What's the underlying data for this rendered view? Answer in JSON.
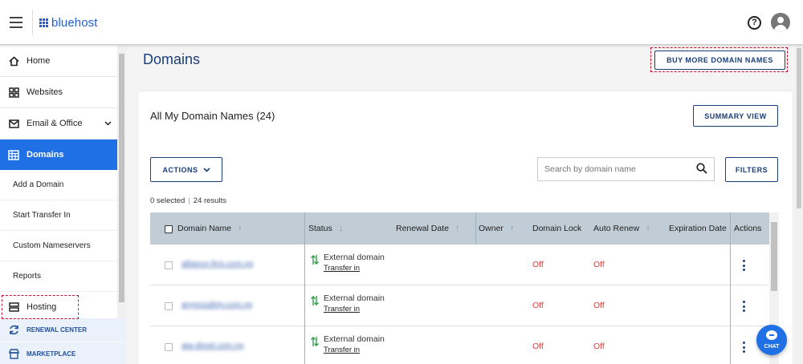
{
  "header": {
    "logo_text": "bluehost",
    "help_glyph": "?"
  },
  "sidebar": {
    "items": [
      {
        "label": "Home",
        "icon": "home-icon"
      },
      {
        "label": "Websites",
        "icon": "websites-icon"
      },
      {
        "label": "Email & Office",
        "icon": "mail-icon",
        "chevron": "⌄"
      },
      {
        "label": "Domains",
        "icon": "domains-icon",
        "active": true
      }
    ],
    "subitems": [
      "Add a Domain",
      "Start Transfer In",
      "Custom Nameservers",
      "Reports"
    ],
    "hosting": "Hosting",
    "renewal_center": "RENEWAL CENTER",
    "marketplace": "MARKETPLACE"
  },
  "main": {
    "title": "Domains",
    "buy_more": "BUY MORE DOMAIN NAMES",
    "card_title": "All My Domain Names (24)",
    "summary_view": "SUMMARY VIEW",
    "actions": "ACTIONS",
    "search_placeholder": "Search by domain name",
    "filters": "FILTERS",
    "selected": "0 selected",
    "results": "24 results",
    "separator": "|"
  },
  "table": {
    "columns": {
      "domain": "Domain Name",
      "status": "Status",
      "renewal": "Renewal Date",
      "owner": "Owner",
      "lock": "Domain Lock",
      "auto_renew": "Auto Renew",
      "expiration": "Expiration Date",
      "actions": "Actions"
    },
    "rows": [
      {
        "domain": "alliance-firm.com.ng",
        "status": "External domain",
        "link": "Transfer in",
        "lock": "Off",
        "auto_renew": "Off"
      },
      {
        "domain": "anyessafety.com.ng",
        "status": "External domain",
        "link": "Transfer in",
        "lock": "Off",
        "auto_renew": "Off"
      },
      {
        "domain": "ata-dimet.com.ng",
        "status": "External domain",
        "link": "Transfer in",
        "lock": "Off",
        "auto_renew": "Off"
      }
    ]
  },
  "chat": {
    "label": "CHAT"
  },
  "colors": {
    "brand": "#1f5ed7",
    "active": "#1f6fe5",
    "navy": "#1a3e7a",
    "off": "#e04040",
    "highlight": "#c8102e"
  }
}
